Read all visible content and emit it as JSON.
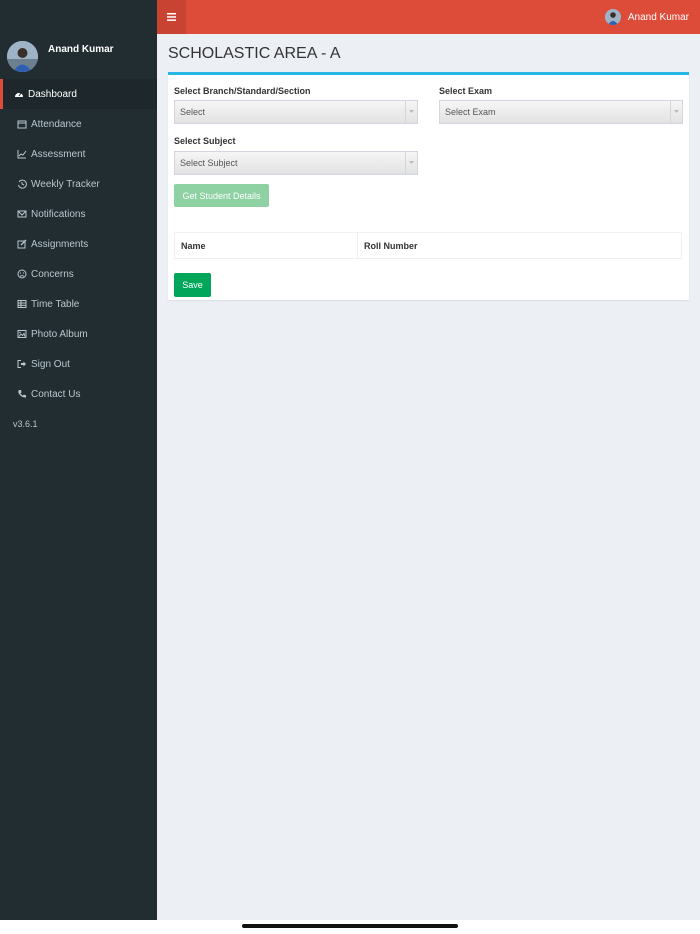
{
  "header": {
    "user_name": "Anand Kumar"
  },
  "sidebar": {
    "user_name": "Anand Kumar",
    "items": [
      {
        "label": "Dashboard",
        "icon": "dashboard-icon"
      },
      {
        "label": "Attendance",
        "icon": "calendar-icon"
      },
      {
        "label": "Assessment",
        "icon": "line-chart-icon"
      },
      {
        "label": "Weekly Tracker",
        "icon": "history-icon"
      },
      {
        "label": "Notifications",
        "icon": "envelope-icon"
      },
      {
        "label": "Assignments",
        "icon": "edit-icon"
      },
      {
        "label": "Concerns",
        "icon": "frown-icon"
      },
      {
        "label": "Time Table",
        "icon": "table-icon"
      },
      {
        "label": "Photo Album",
        "icon": "image-icon"
      },
      {
        "label": "Sign Out",
        "icon": "sign-out-icon"
      },
      {
        "label": "Contact Us",
        "icon": "phone-icon"
      }
    ],
    "version": "v3.6.1"
  },
  "main": {
    "title": "SCHOLASTIC AREA - A",
    "branch_label": "Select Branch/Standard/Section",
    "branch_value": "Select",
    "exam_label": "Select Exam",
    "exam_value": "Select Exam",
    "subject_label": "Select Subject",
    "subject_value": "Select Subject",
    "get_button": "Get Student Details",
    "table_headers": [
      "Name",
      "Roll Number"
    ],
    "save_button": "Save"
  },
  "colors": {
    "header": "#dd4b39",
    "sidebar": "#222d32",
    "box_border": "#29b6e6",
    "save": "#00a65a",
    "get_button": "#8ed1a2"
  }
}
